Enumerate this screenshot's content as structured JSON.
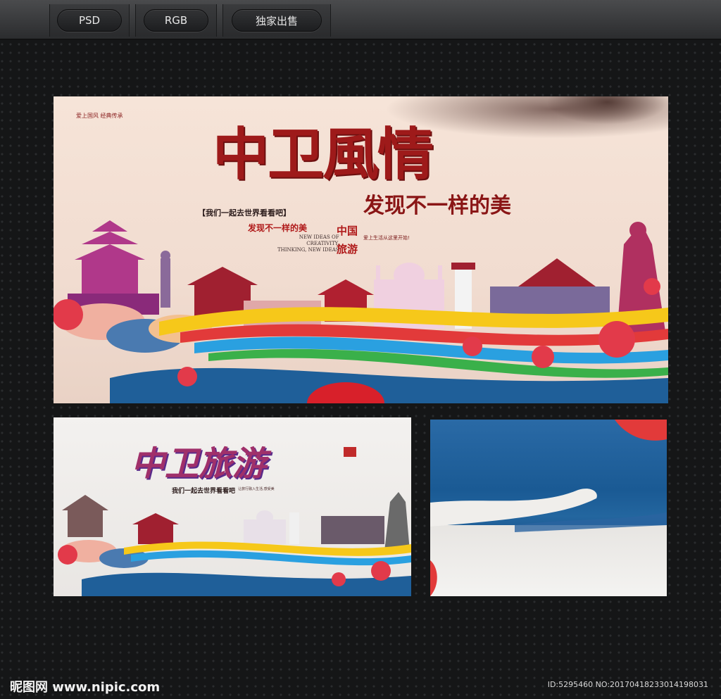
{
  "toolbar": {
    "badges": [
      {
        "label": "PSD"
      },
      {
        "label": "RGB"
      },
      {
        "label": "独家出售"
      }
    ]
  },
  "main_poster": {
    "title": "中卫風情",
    "subtitle": "发现不一样的美",
    "slogan_bracket": "【我们一起去世界看看吧】",
    "slogan_red": "发现不一样的美",
    "english_lines": [
      "NEW IDEAS OF",
      "CREATIVITY,",
      "THINKING, NEW IDEAS"
    ],
    "china_label": "中国",
    "travel_label": "旅游",
    "side_line": "爱上生活从这里开始!",
    "corner_note": "爱上国风 经典传承"
  },
  "small_poster": {
    "title": "中卫旅游",
    "slogan": "我们一起去世界看看吧",
    "side_line": "让旅行融入生活,感受美"
  },
  "footer": {
    "logo": "昵图网 www.nipic.com",
    "id_text": "ID:5295460 NO:20170418233014198031"
  },
  "colors": {
    "title_red": "#9e1a1a",
    "background": "#151617",
    "toolbar": "#3a3b3d",
    "wave_blue": "#1f5f99"
  }
}
